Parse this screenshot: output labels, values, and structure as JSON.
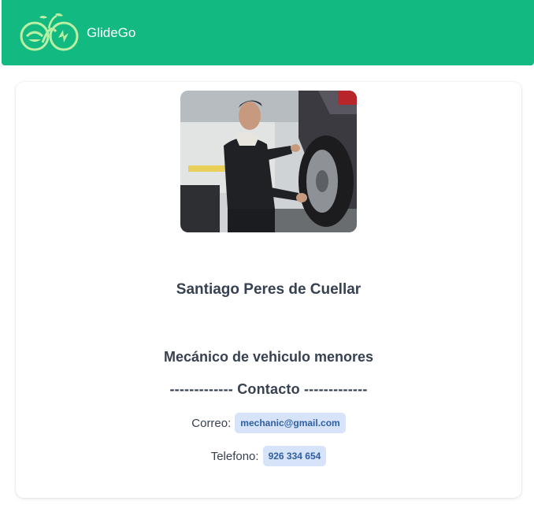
{
  "header": {
    "brand": "GlideGo",
    "logo_icon": "bike-leaf-logo-icon"
  },
  "profile": {
    "photo_alt": "Santiago Peres de Cuellar",
    "name": "Santiago Peres de Cuellar",
    "role": "Mecánico de vehiculo menores",
    "contact_heading": "------------- Contacto -------------",
    "email_label": "Correo:",
    "email_value": "mechanic@gmail.com",
    "phone_label": "Telefono:",
    "phone_value": "926 334 654"
  },
  "colors": {
    "header_bg": "#12b981",
    "badge_bg": "#d6e3f8",
    "badge_text": "#2f5fa0",
    "text": "#374151"
  }
}
